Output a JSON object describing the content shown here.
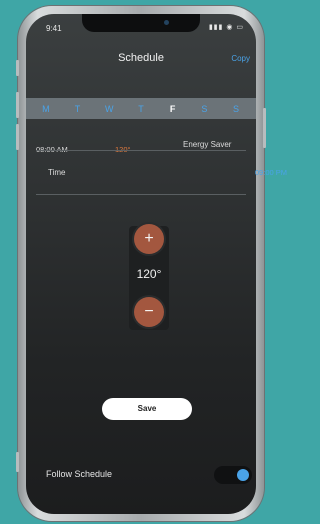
{
  "status": {
    "time": "9:41",
    "icons": "▮▮▮ ◉ ▭"
  },
  "header": {
    "title": "Schedule",
    "copy_label": "Copy"
  },
  "days": [
    {
      "label": "M",
      "active": false
    },
    {
      "label": "T",
      "active": false
    },
    {
      "label": "W",
      "active": false
    },
    {
      "label": "T",
      "active": false
    },
    {
      "label": "F",
      "active": true
    },
    {
      "label": "S",
      "active": false
    },
    {
      "label": "S",
      "active": false
    }
  ],
  "schedule_row": {
    "time": "08:00 AM",
    "temp": "120°",
    "mode": "Energy Saver"
  },
  "time_row": {
    "label": "Time",
    "value": "09:00 PM"
  },
  "stepper": {
    "plus": "+",
    "minus": "−",
    "value": "120°"
  },
  "save_label": "Save",
  "follow_schedule": {
    "label": "Follow Schedule",
    "enabled": true
  },
  "colors": {
    "accent": "#4aa3e8",
    "temp": "#e07a3e",
    "stepper_button": "#a3573f",
    "background": "#3fa6a6"
  }
}
